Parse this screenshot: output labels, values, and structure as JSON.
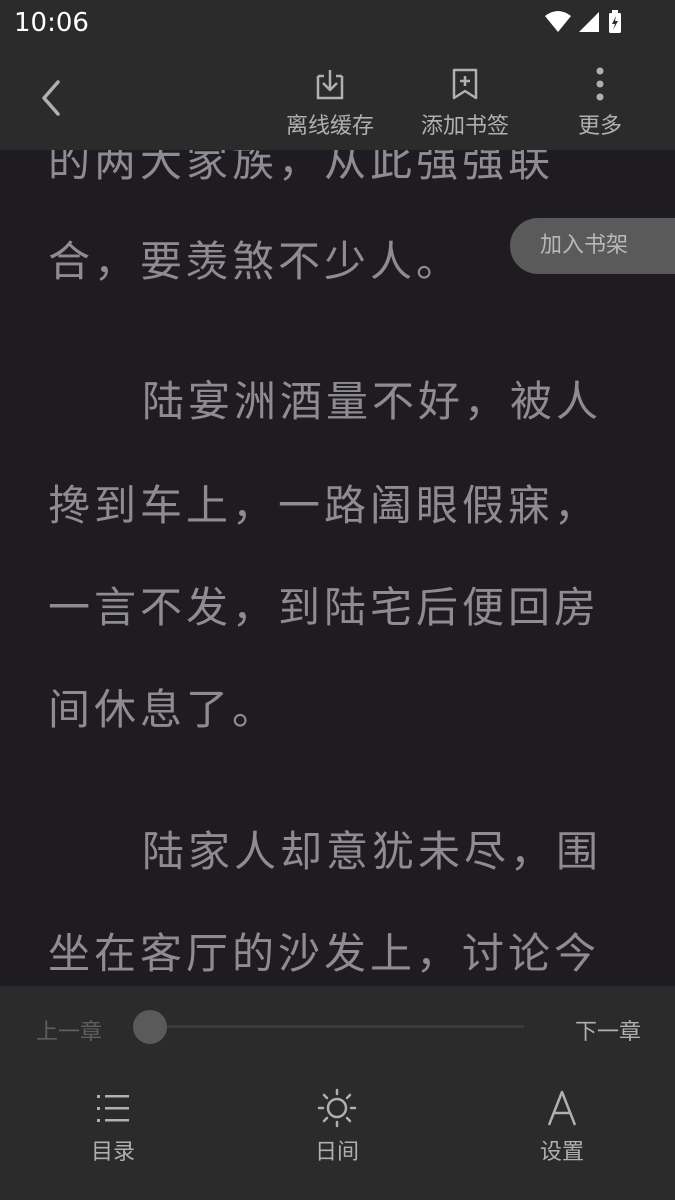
{
  "status_bar": {
    "time": "10:06"
  },
  "toolbar": {
    "offline_cache": "离线缓存",
    "add_bookmark": "添加书签",
    "more": "更多"
  },
  "shelf_button": "加入书架",
  "content": {
    "lines": [
      "的两大家族，从此强强联",
      "合，要羡煞不少人。",
      "陆宴洲酒量不好，被人",
      "搀到车上，一路阖眼假寐，",
      "一言不发，到陆宅后便回房",
      "间休息了。",
      "陆家人却意犹未尽，围",
      "坐在客厅的沙发上，讨论今"
    ]
  },
  "bottom": {
    "prev_chapter": "上一章",
    "next_chapter": "下一章",
    "progress": 0,
    "nav": {
      "catalog": "目录",
      "day_mode": "日间",
      "settings": "设置"
    }
  }
}
